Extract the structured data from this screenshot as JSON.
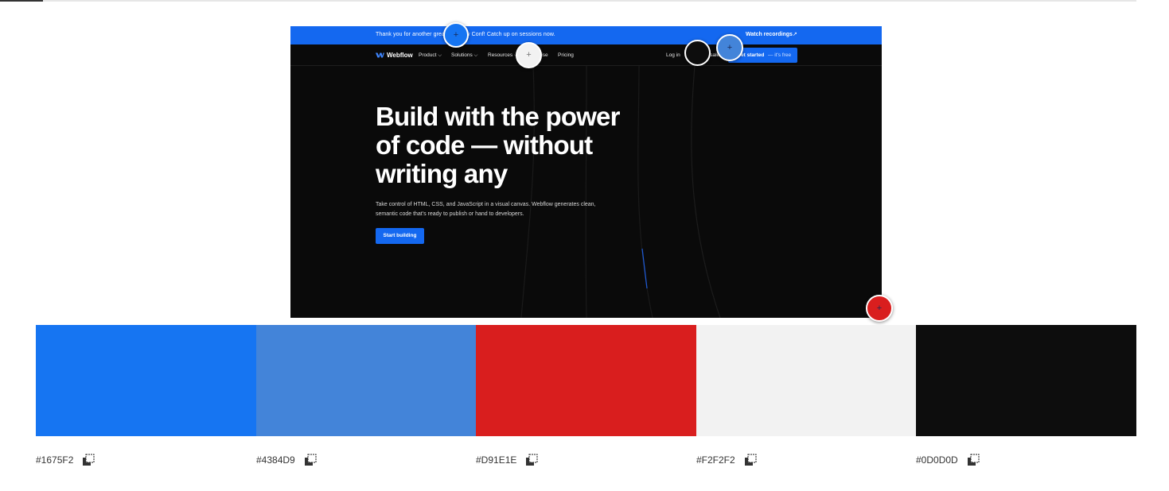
{
  "embedded_site": {
    "banner": {
      "text": "Thank you for another great Webflow Conf! Catch up on sessions now.",
      "link": "Watch recordings",
      "link_arrow": "↗"
    },
    "nav": {
      "logo": "Webflow",
      "items": [
        "Product ⌵",
        "Solutions ⌵",
        "Resources ⌵",
        "Enterprise",
        "Pricing"
      ],
      "login": "Log in",
      "contact": "Contact sales",
      "cta": "Get started",
      "cta_sub": "— it's free"
    },
    "hero": {
      "title": "Build with the power of code — without writing any",
      "subtitle": "Take control of HTML, CSS, and JavaScript in a visual canvas. Webflow generates clean, semantic code that's ready to publish or hand to developers.",
      "button": "Start building"
    }
  },
  "markers": [
    {
      "name": "marker-1",
      "color": "#1675F2",
      "glyph": "+"
    },
    {
      "name": "marker-4",
      "color": "#F2F2F2",
      "glyph": "+"
    },
    {
      "name": "marker-5",
      "color": "#0D0D0D",
      "glyph": ""
    },
    {
      "name": "marker-2",
      "color": "#4384D9",
      "glyph": "+"
    },
    {
      "name": "marker-3",
      "color": "#D91E1E",
      "glyph": "+"
    }
  ],
  "palette": [
    {
      "hex": "#1675F2",
      "color": "#1675F2"
    },
    {
      "hex": "#4384D9",
      "color": "#4384D9"
    },
    {
      "hex": "#D91E1E",
      "color": "#D91E1E"
    },
    {
      "hex": "#F2F2F2",
      "color": "#F2F2F2"
    },
    {
      "hex": "#0D0D0D",
      "color": "#0D0D0D"
    }
  ],
  "icons": {
    "copy": "copy-icon",
    "logo": "webflow-logo-icon"
  }
}
